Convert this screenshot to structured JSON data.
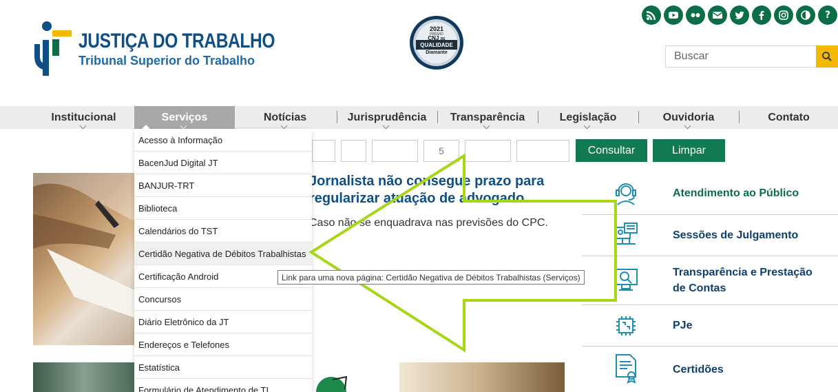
{
  "header": {
    "logo_title": "JUSTIÇA DO TRABALHO",
    "logo_subtitle": "Tribunal Superior do Trabalho",
    "seal": {
      "year": "2021",
      "line1": "PRÊMIO",
      "line2": "CNJ",
      "line3": "DE",
      "line4": "QUALIDADE",
      "line5": "Diamante"
    },
    "social_icons": [
      "rss-icon",
      "youtube-icon",
      "flickr-icon",
      "email-icon",
      "twitter-icon",
      "facebook-icon",
      "instagram-icon",
      "contrast-icon",
      "help-icon"
    ],
    "search": {
      "placeholder": "Buscar"
    }
  },
  "nav": {
    "items": [
      {
        "label": "Institucional"
      },
      {
        "label": "Serviços"
      },
      {
        "label": "Notícias"
      },
      {
        "label": "Jurisprudência"
      },
      {
        "label": "Transparência"
      },
      {
        "label": "Legislação"
      },
      {
        "label": "Ouvidoria"
      },
      {
        "label": "Contato"
      }
    ],
    "active": "Serviços"
  },
  "dropdown": {
    "items": [
      {
        "label": "Acesso à Informação"
      },
      {
        "label": "BacenJud Digital JT"
      },
      {
        "label": "BANJUR-TRT"
      },
      {
        "label": "Biblioteca"
      },
      {
        "label": "Calendários do TST"
      },
      {
        "label": "Certidão Negativa de Débitos Trabalhistas"
      },
      {
        "label": "Certificação Android"
      },
      {
        "label": "Concursos"
      },
      {
        "label": "Diário Eletrônico da JT"
      },
      {
        "label": "Endereços e Telefones"
      },
      {
        "label": "Estatística"
      },
      {
        "label": "Formulário de Atendimento de TI"
      }
    ],
    "hovered": "Certidão Negativa de Débitos Trabalhistas"
  },
  "tooltip": "Link para uma nova página: Certidão Negativa de Débitos Trabalhistas (Serviços)",
  "form": {
    "field_value": "5",
    "consultar_label": "Consultar",
    "limpar_label": "Limpar"
  },
  "news": {
    "title": "Jornalista não consegue prazo para regularizar atuação de advogado",
    "excerpt": "Caso não se enquadrava nas previsões do CPC."
  },
  "services": [
    {
      "label": "Atendimento ao Público",
      "icon": "headset-icon"
    },
    {
      "label": "Sessões de Julgamento",
      "icon": "video-session-icon"
    },
    {
      "label": "Transparência e Prestação de Contas",
      "icon": "monitor-search-icon"
    },
    {
      "label": "PJe",
      "icon": "chip-icon"
    },
    {
      "label": "Certidões",
      "icon": "certificate-icon"
    }
  ],
  "colors": {
    "brand_blue": "#0e4f86",
    "brand_green": "#0b6e46",
    "accent_yellow": "#f5b800",
    "arrow_green": "#a6d616"
  }
}
